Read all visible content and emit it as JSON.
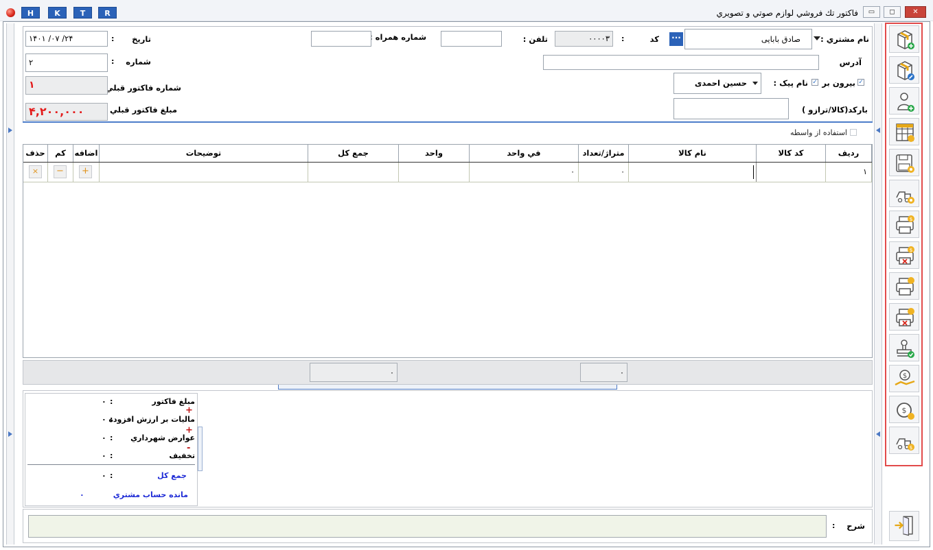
{
  "titlebar": {
    "hotkeys": [
      "H",
      "K",
      "T",
      "R"
    ],
    "title": "فاكتور تك فروشي لوازم صوتي و تصويري",
    "min": "▭",
    "max": "◻",
    "close": "✕"
  },
  "header": {
    "customer_name_label": "نام مشتري :",
    "customer_name_value": "صادق بابایی",
    "code_label": "كد",
    "colon": ":",
    "code_value": "۰۰۰۰۳",
    "phone_label": "تلفن :",
    "phone_value": "",
    "mobile_label": "شماره همراه :",
    "mobile_value": "",
    "date_label": "تاريخ",
    "date_value": "۱۴۰۱ /۰۷ /۲۴",
    "number_label": "شماره",
    "number_value": "۲",
    "address_label": "آدرس",
    "address_value": "",
    "outgoing_label": "بيرون بر",
    "courier_label": "نام پيک :",
    "courier_value": "حسین احمدی",
    "prev_invoice_no_label": "شماره فاكتور قبلي :",
    "prev_invoice_no_value": "۱",
    "barcode_label": "باركد(كالا/ترازو )",
    "barcode_value": "",
    "prev_invoice_amount_label": "مبلغ فاكتور قبلي :",
    "prev_invoice_amount_value": "۴,۲۰۰,۰۰۰",
    "intermediary_label": "استفاده از واسطه"
  },
  "table": {
    "columns": [
      "رديف",
      "كد كالا",
      "نام كالا",
      "متراژ/تعداد",
      "في واحد",
      "واحد",
      "جمع كل",
      "توضيحات",
      "اضافه",
      "كم",
      "حذف"
    ],
    "row": {
      "index": "۱",
      "code": "",
      "name": "",
      "qty": "۰",
      "unit_price": "۰",
      "unit": "",
      "total": "",
      "desc": "",
      "add": "+",
      "minus": "−",
      "delete": "×"
    }
  },
  "footer": {
    "sum_total": "۰",
    "sum_qty": "۰"
  },
  "summary": {
    "invoice_amount_label": "مبلغ فاكتور",
    "invoice_amount_value": "۰",
    "vat_label": "ماليات بر ارزش افزوده",
    "vat_value": "۰",
    "municipal_label": "عوارض شهرداري",
    "municipal_value": "۰",
    "discount_label": "تخفيف",
    "discount_value": "۰",
    "total_label": "جمع كل",
    "total_value": "۰",
    "balance_label": "مانده حساب مشتري",
    "balance_value": "۰",
    "plus": "+",
    "minus": "-"
  },
  "notes": {
    "label": "شرح",
    "value": ""
  },
  "toolbar": {
    "icons": [
      "new-invoice-icon",
      "edit-invoice-icon",
      "add-customer-icon",
      "price-table-icon",
      "save-preview-icon",
      "delivery-preview-icon",
      "print-invoice-icon",
      "delete-print-icon",
      "print-alt-icon",
      "delete-alt-icon",
      "approve-stamp-icon",
      "payment-receive-icon",
      "coin-exchange-icon",
      "delivery-cost-icon"
    ],
    "exit_icon": "exit-door-icon",
    "accent": "#e24a4a"
  }
}
